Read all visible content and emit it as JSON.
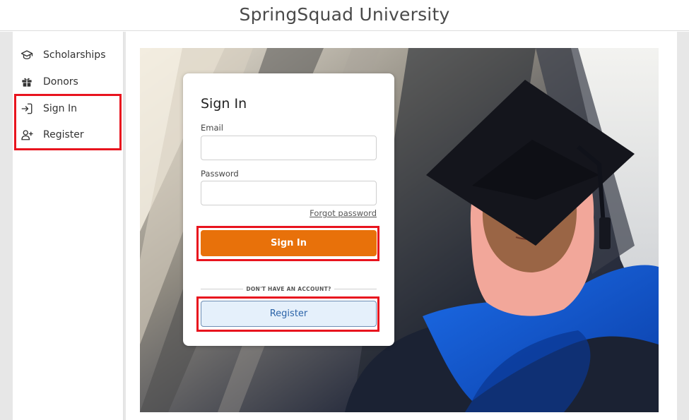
{
  "header": {
    "title": "SpringSquad University"
  },
  "sidebar": {
    "items": [
      {
        "label": "Scholarships",
        "icon": "graduation-cap-icon"
      },
      {
        "label": "Donors",
        "icon": "gift-icon"
      },
      {
        "label": "Sign In",
        "icon": "sign-in-icon"
      },
      {
        "label": "Register",
        "icon": "user-plus-icon"
      }
    ]
  },
  "signin_card": {
    "title": "Sign In",
    "email_label": "Email",
    "email_value": "",
    "password_label": "Password",
    "password_value": "",
    "forgot_link": "Forgot password",
    "signin_button": "Sign In",
    "divider_text": "DON'T HAVE AN ACCOUNT?",
    "register_button": "Register"
  },
  "colors": {
    "accent_orange": "#e8710a",
    "register_bg": "#e5f0fb",
    "register_text": "#2b63a8",
    "highlight_red": "#e8141e"
  }
}
